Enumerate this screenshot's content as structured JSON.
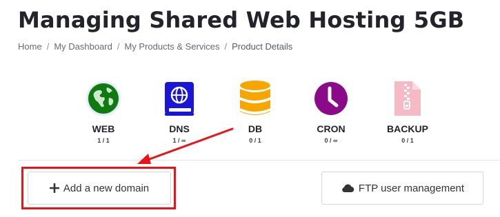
{
  "page": {
    "title": "Managing Shared Web Hosting 5GB"
  },
  "breadcrumb": {
    "separator": "/",
    "items": [
      "Home",
      "My Dashboard",
      "My Products & Services"
    ],
    "current": "Product Details"
  },
  "stats": [
    {
      "label": "WEB",
      "count": "1 / 1",
      "icon": "globe-icon",
      "color": "#0f7a0f"
    },
    {
      "label": "DNS",
      "count": "1 / ∞",
      "icon": "dns-book-icon",
      "color": "#1a16d8"
    },
    {
      "label": "DB",
      "count": "0 / 1",
      "icon": "database-icon",
      "color": "#f7a600"
    },
    {
      "label": "CRON",
      "count": "0 / ∞",
      "icon": "clock-icon",
      "color": "#8a0a8a"
    },
    {
      "label": "BACKUP",
      "count": "0 / 1",
      "icon": "zip-file-icon",
      "color": "#f6b9c6"
    }
  ],
  "actions": {
    "add_domain": {
      "label": "Add a new domain",
      "icon": "plus-icon"
    },
    "ftp": {
      "label": "FTP user management",
      "icon": "cloud-icon"
    }
  },
  "annotation": {
    "color": "#e8141a"
  }
}
